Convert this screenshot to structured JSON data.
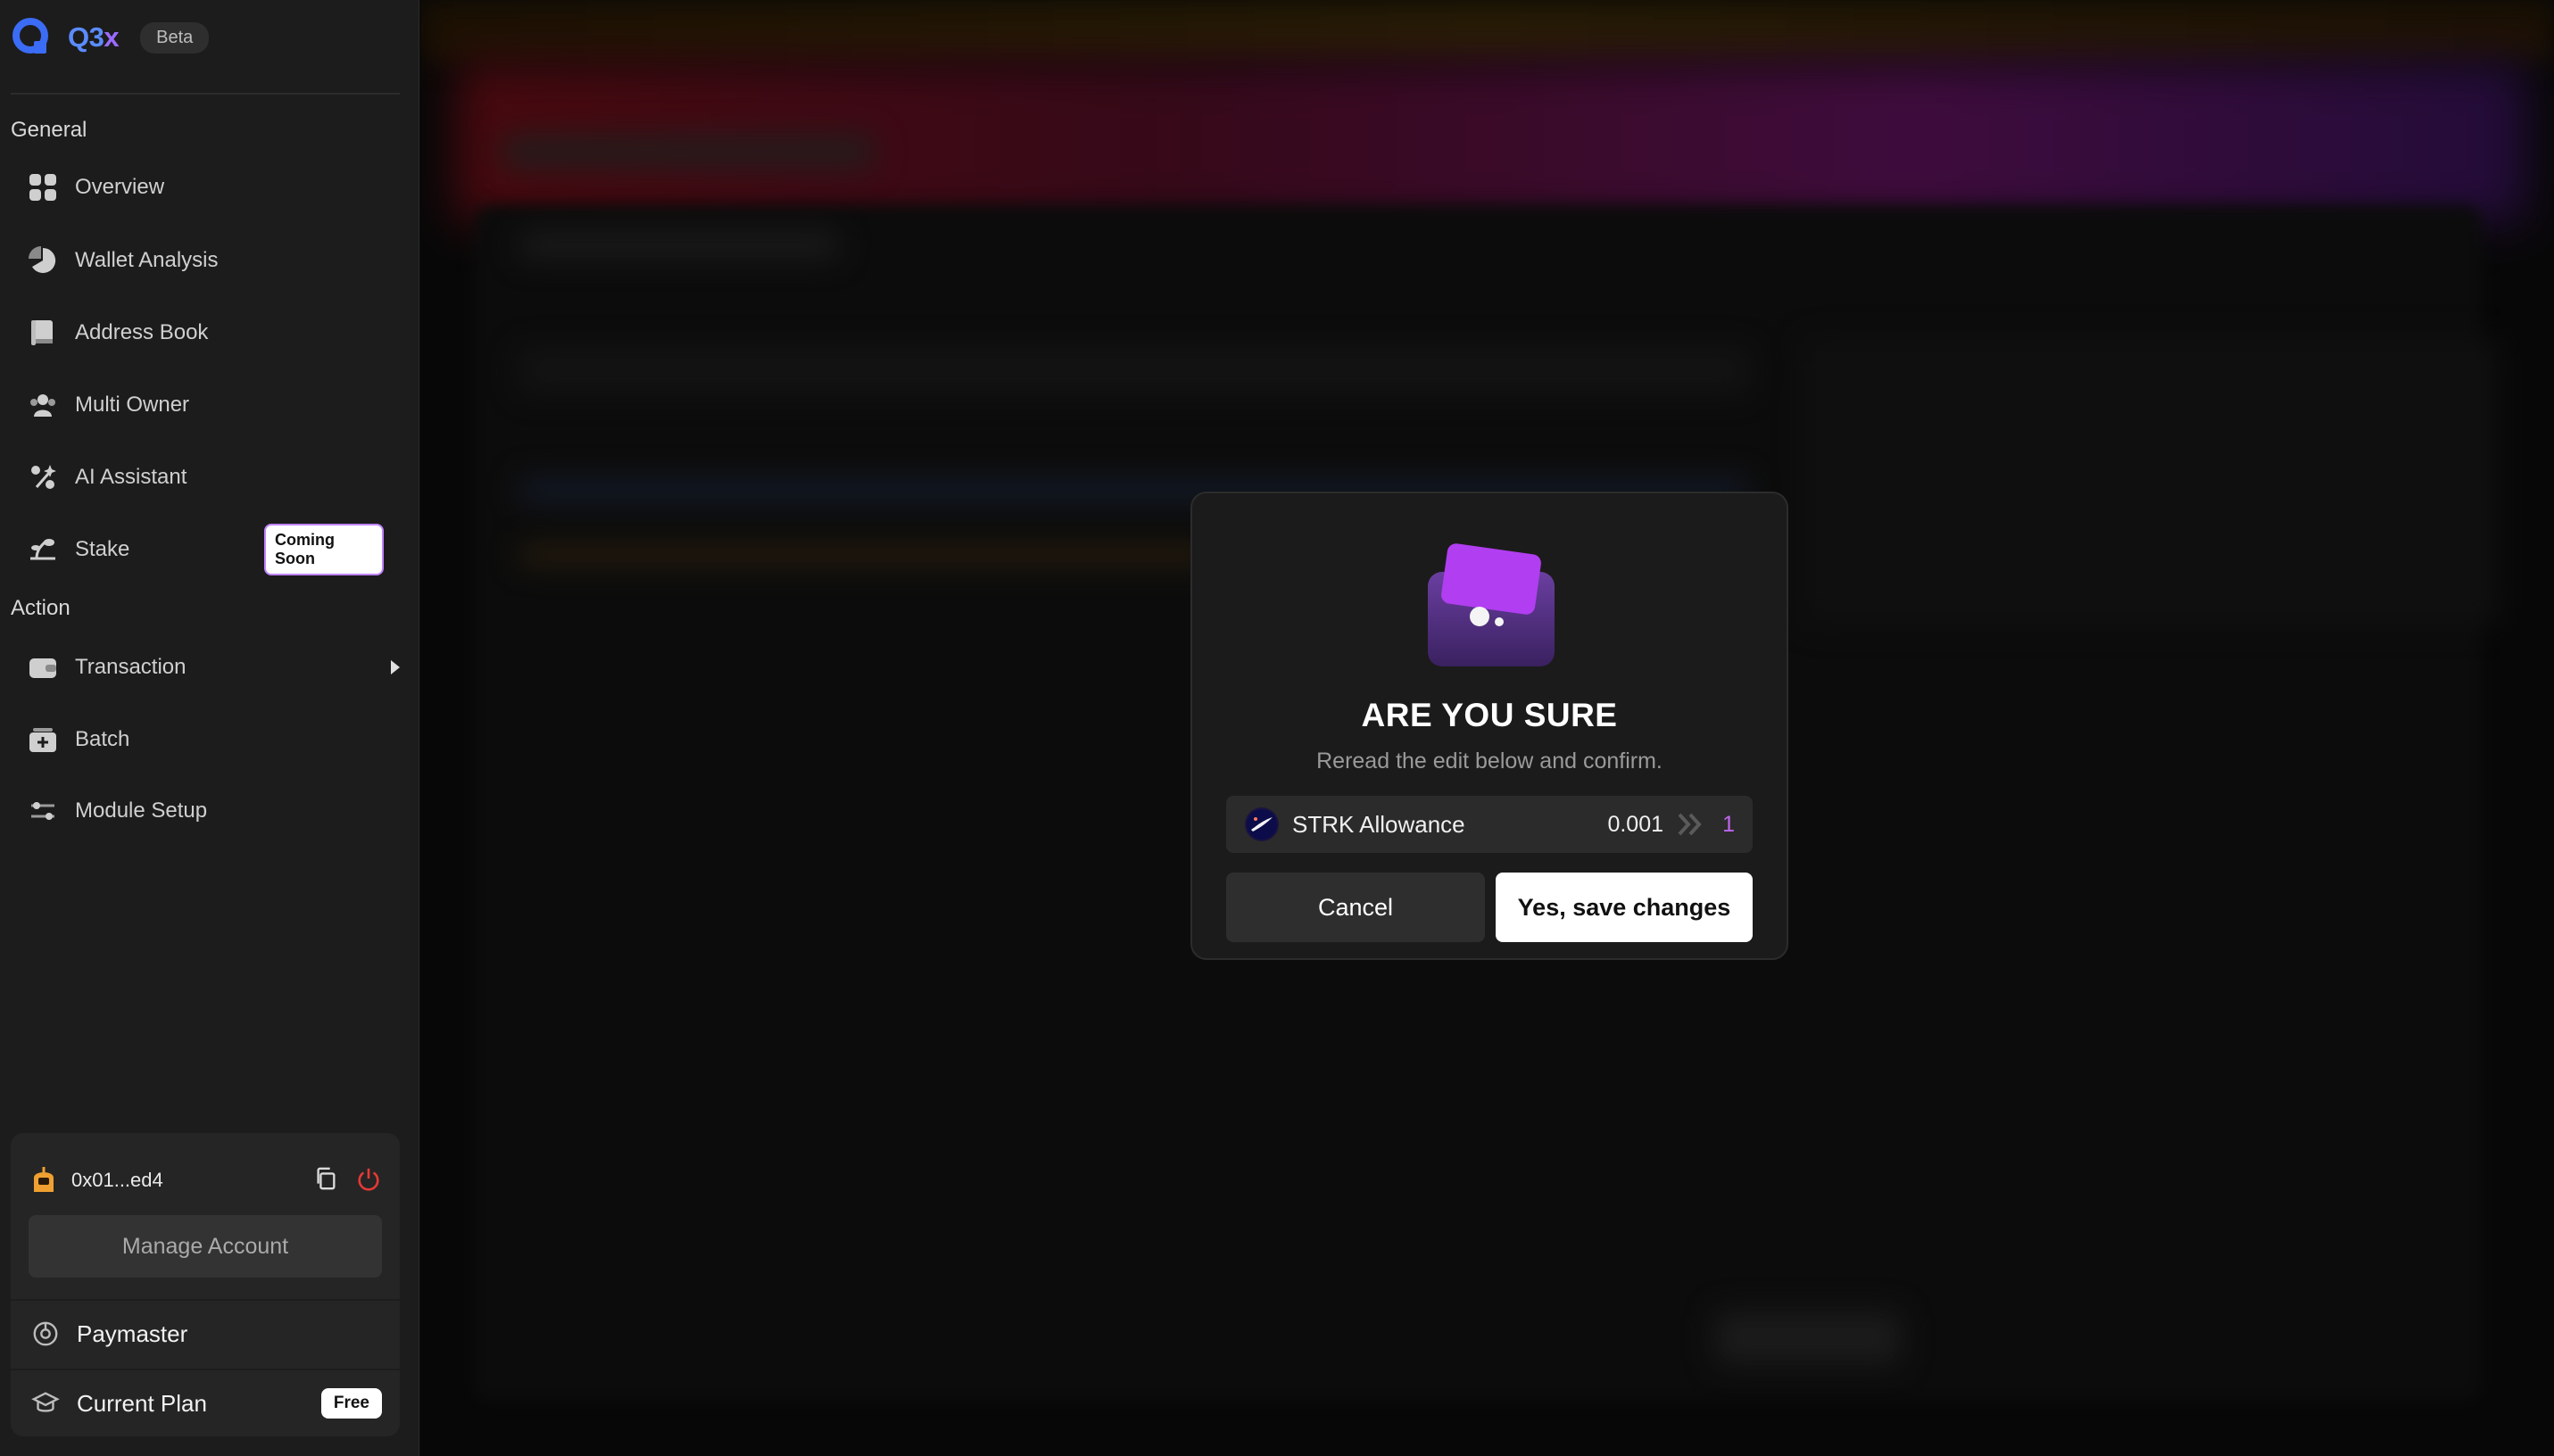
{
  "brand": {
    "name_part1": "Q3",
    "name_part2": "x",
    "badge": "Beta"
  },
  "sidebar": {
    "sections": {
      "general": "General",
      "action": "Action"
    },
    "general_items": [
      {
        "label": "Overview",
        "icon": "grid-icon"
      },
      {
        "label": "Wallet Analysis",
        "icon": "pie-chart-icon"
      },
      {
        "label": "Address Book",
        "icon": "book-icon"
      },
      {
        "label": "Multi Owner",
        "icon": "users-icon"
      },
      {
        "label": "AI Assistant",
        "icon": "ai-sparkle-icon"
      },
      {
        "label": "Stake",
        "icon": "stake-icon",
        "badge": "Coming Soon"
      }
    ],
    "action_items": [
      {
        "label": "Transaction",
        "icon": "wallet-icon"
      },
      {
        "label": "Batch",
        "icon": "batch-icon"
      },
      {
        "label": "Module Setup",
        "icon": "sliders-icon"
      }
    ]
  },
  "account": {
    "address": "0x01...ed4",
    "manage_label": "Manage Account",
    "paymaster_label": "Paymaster",
    "plan_label": "Current Plan",
    "plan_badge": "Free"
  },
  "modal": {
    "title": "ARE YOU SURE",
    "subtitle": "Reread the edit below and confirm.",
    "edit": {
      "label": "STRK Allowance",
      "old_value": "0.001",
      "new_value": "1"
    },
    "cancel_label": "Cancel",
    "confirm_label": "Yes, save changes"
  },
  "colors": {
    "accent_purple": "#c065f0",
    "brand_blue": "#5b8cff",
    "sidebar_bg": "#1c1c1c",
    "modal_bg": "#1b1b1b"
  }
}
